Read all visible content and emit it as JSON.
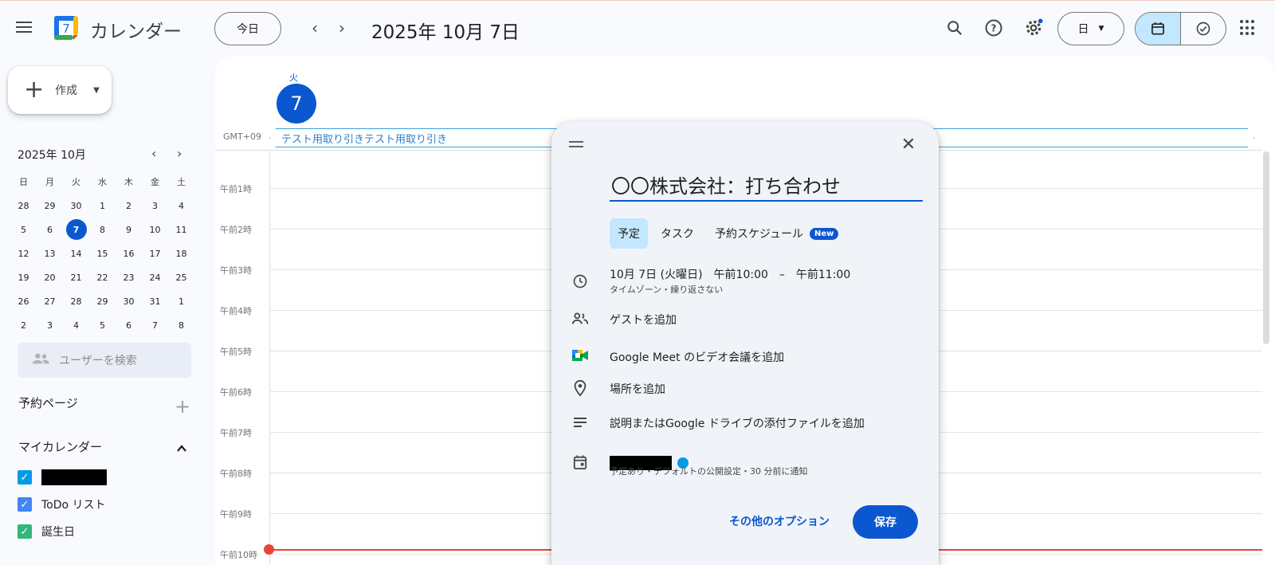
{
  "app": {
    "title": "カレンダー",
    "logo_text": "7"
  },
  "header": {
    "today_label": "今日",
    "date_title": "2025年 10月 7日",
    "view_select": "日",
    "icons": [
      "menu-icon",
      "search-icon",
      "help-icon",
      "settings-icon",
      "calendar-view-icon",
      "tasks-view-icon",
      "apps-icon"
    ]
  },
  "sidebar": {
    "create_label": "作成",
    "mini_calendar": {
      "title": "2025年 10月",
      "weekdays": [
        "日",
        "月",
        "火",
        "水",
        "木",
        "金",
        "土"
      ],
      "weeks": [
        [
          "28",
          "29",
          "30",
          "1",
          "2",
          "3",
          "4"
        ],
        [
          "5",
          "6",
          "7",
          "8",
          "9",
          "10",
          "11"
        ],
        [
          "12",
          "13",
          "14",
          "15",
          "16",
          "17",
          "18"
        ],
        [
          "19",
          "20",
          "21",
          "22",
          "23",
          "24",
          "25"
        ],
        [
          "26",
          "27",
          "28",
          "29",
          "30",
          "31",
          "1"
        ],
        [
          "2",
          "3",
          "4",
          "5",
          "6",
          "7",
          "8"
        ]
      ],
      "selected": "7"
    },
    "user_search_placeholder": "ユーザーを検索",
    "booking_pages_label": "予約ページ",
    "my_calendars_label": "マイカレンダー",
    "calendars": [
      {
        "label": "",
        "color": "#039be5",
        "checked": true
      },
      {
        "label": "ToDo リスト",
        "color": "#4285f4",
        "checked": true
      },
      {
        "label": "誕生日",
        "color": "#33b679",
        "checked": true
      }
    ]
  },
  "day_view": {
    "weekday": "火",
    "day_number": "7",
    "timezone": "GMT+09",
    "all_day_event": "テスト用取り引きテスト用取り引き",
    "hours": [
      "午前1時",
      "午前2時",
      "午前3時",
      "午前4時",
      "午前5時",
      "午前6時",
      "午前7時",
      "午前8時",
      "午前9時",
      "午前10時"
    ]
  },
  "dialog": {
    "title_value": "〇〇株式会社：打ち合わせ",
    "tabs": [
      "予定",
      "タスク",
      "予約スケジュール"
    ],
    "new_badge": "New",
    "date_time": "10月 7日 (火曜日)　午前10:00　–　午前11:00",
    "date_time_sub": "タイムゾーン・繰り返さない",
    "add_guests": "ゲストを追加",
    "add_meet": "Google Meet のビデオ会議を追加",
    "add_location": "場所を追加",
    "add_description": "説明またはGoogle ドライブの添付ファイルを追加",
    "calendar_sub": "予定あり・デフォルトの公開設定・30 分前に通知",
    "more_options": "その他のオプション",
    "save": "保存"
  },
  "colors": {
    "accent": "#0b57d0",
    "now_line": "#ea4335",
    "selected_bg": "#c2e7ff"
  }
}
